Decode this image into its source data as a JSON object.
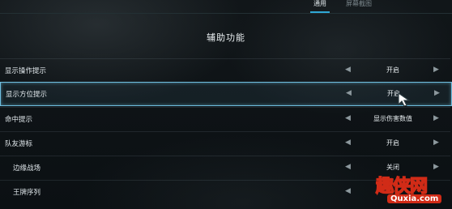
{
  "tabs": [
    {
      "label": "通用",
      "active": true
    },
    {
      "label": "屏幕截图",
      "active": false
    }
  ],
  "title": "辅助功能",
  "rows": [
    {
      "label": "显示操作提示",
      "value": "开启",
      "indent": false,
      "selected": false
    },
    {
      "label": "显示方位提示",
      "value": "开启",
      "indent": false,
      "selected": true
    },
    {
      "label": "命中提示",
      "value": "显示伤害数值",
      "indent": false,
      "selected": false
    },
    {
      "label": "队友游标",
      "value": "开启",
      "indent": false,
      "selected": false
    },
    {
      "label": "边缘战场",
      "value": "关闭",
      "indent": true,
      "selected": false
    },
    {
      "label": "王牌序列",
      "value": "",
      "indent": true,
      "selected": false
    }
  ],
  "arrows": {
    "left": "◀",
    "right": "▶"
  },
  "watermark": {
    "top": "趣侠网",
    "bottom": "Quxia.com"
  },
  "colors": {
    "accent": "#2fa8d6",
    "selection_border": "#6fbfe0",
    "logo_yellow": "#ffd21f",
    "logo_red": "#d12b17"
  }
}
